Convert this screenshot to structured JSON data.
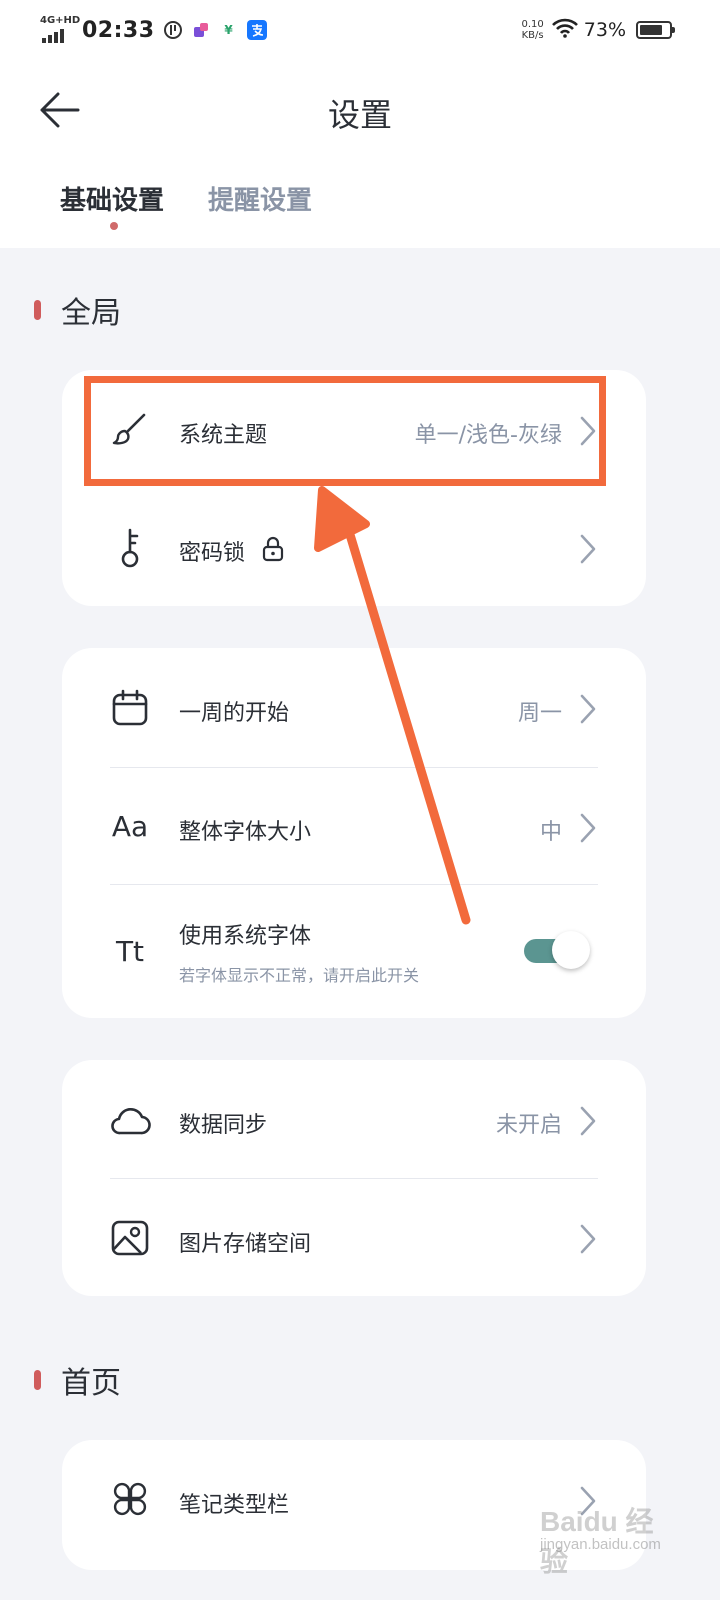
{
  "status_bar": {
    "network": "4G+HD",
    "time": "02:33",
    "speed_value": "0.10",
    "speed_unit": "KB/s",
    "battery": "73%",
    "battery_level": 0.73
  },
  "header": {
    "title": "设置"
  },
  "tabs": [
    {
      "label": "基础设置",
      "active": true
    },
    {
      "label": "提醒设置",
      "active": false
    }
  ],
  "sections": {
    "global": {
      "title": "全局"
    },
    "home": {
      "title": "首页"
    }
  },
  "card1": {
    "theme": {
      "icon": "paintbrush-icon",
      "label": "系统主题",
      "value": "单一/浅色-灰绿"
    },
    "lock": {
      "icon": "key-icon",
      "label": "密码锁"
    }
  },
  "card2": {
    "week_start": {
      "icon": "calendar-icon",
      "label": "一周的开始",
      "value": "周一"
    },
    "font_size": {
      "icon": "font-size-icon",
      "glyph": "Aa",
      "label": "整体字体大小",
      "value": "中"
    },
    "system_font": {
      "icon": "font-icon",
      "glyph": "Tt",
      "label": "使用系统字体",
      "sub": "若字体显示不正常，请开启此开关",
      "enabled": true
    }
  },
  "card3": {
    "sync": {
      "icon": "cloud-icon",
      "label": "数据同步",
      "value": "未开启"
    },
    "images": {
      "icon": "image-icon",
      "label": "图片存储空间"
    }
  },
  "card4": {
    "note_types": {
      "icon": "grid-icon",
      "label": "笔记类型栏"
    }
  },
  "watermark": {
    "text": "Baidu 经验",
    "url": "jingyan.baidu.com"
  },
  "colors": {
    "accent_toggle": "#5b9591",
    "section_marker": "#d05c5c",
    "annotation": "#f26a3c"
  }
}
